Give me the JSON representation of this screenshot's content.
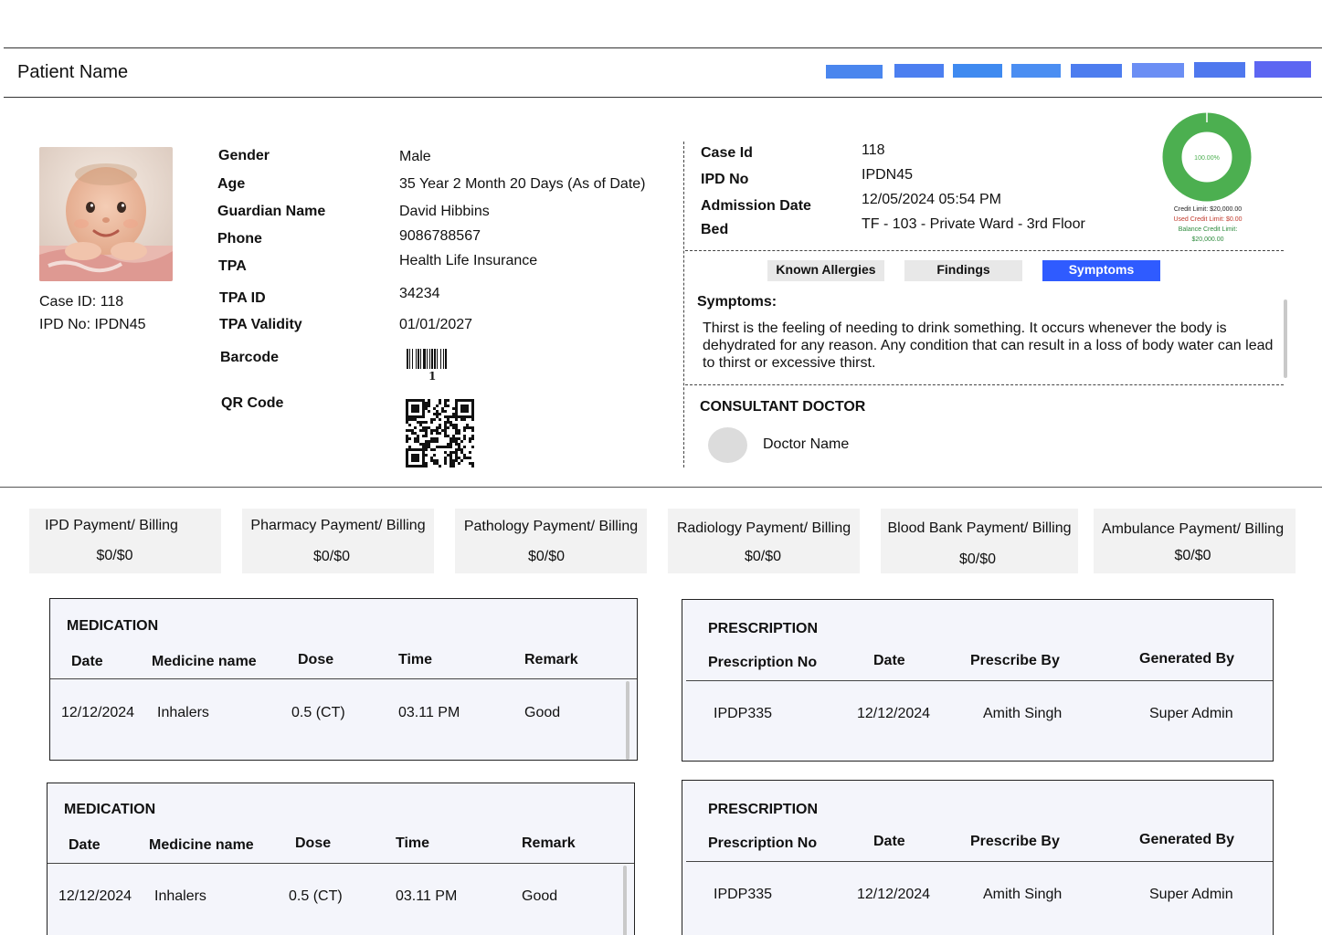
{
  "header": {
    "patient_name": "Patient Name",
    "toolbar_colors": [
      "#4a86ee",
      "#4c7ff0",
      "#3f8af0",
      "#4b8ef2",
      "#4d7def",
      "#6b8ef4",
      "#4f78ee",
      "#5d66f2"
    ]
  },
  "profile": {
    "case_id_text": "Case ID: 118",
    "ipd_no_text": "IPD No: IPDN45"
  },
  "details": {
    "gender_label": "Gender",
    "gender_value": "Male",
    "age_label": "Age",
    "age_value": "35 Year 2 Month 20 Days (As of Date)",
    "guardian_label": "Guardian Name",
    "guardian_value": "David Hibbins",
    "phone_label": "Phone",
    "phone_value": "9086788567",
    "tpa_label": "TPA",
    "tpa_value": "Health Life Insurance",
    "tpa_id_label": "TPA ID",
    "tpa_id_value": "34234",
    "tpa_validity_label": "TPA Validity",
    "tpa_validity_value": "01/01/2027",
    "barcode_label": "Barcode",
    "barcode_value": "1",
    "qr_label": "QR Code"
  },
  "case": {
    "case_id_label": "Case Id",
    "case_id_value": "118",
    "ipd_label": "IPD No",
    "ipd_value": "IPDN45",
    "admission_label": "Admission Date",
    "admission_value": "12/05/2024 05:54 PM",
    "bed_label": "Bed",
    "bed_value": "TF - 103 - Private Ward - 3rd Floor"
  },
  "credit": {
    "percent": "100.00%",
    "credit_limit": "Credit Limit: $20,000.00",
    "used_credit": "Used Credit Limit: $0.00",
    "balance_label": "Balance Credit Limit:",
    "balance_value": "$20,000.00",
    "balance_fraction": 1.0,
    "ring_color": "#4caf50",
    "used_color": "#c0392b",
    "balance_color": "#2e8b3e"
  },
  "tabs": {
    "allergies": "Known Allergies",
    "findings": "Findings",
    "symptoms": "Symptoms",
    "active": "symptoms"
  },
  "symptoms": {
    "heading": "Symptoms:",
    "text": "Thirst is the feeling of needing to drink something. It occurs whenever the body is dehydrated for any reason. Any condition that can result in a loss of body water can lead to thirst or excessive thirst."
  },
  "consultant": {
    "heading": "CONSULTANT DOCTOR",
    "doctor_name": "Doctor Name"
  },
  "billing": [
    {
      "title": "IPD Payment/ Billing",
      "value": "$0/$0"
    },
    {
      "title": "Pharmacy Payment/ Billing",
      "value": "$0/$0"
    },
    {
      "title": "Pathology Payment/ Billing",
      "value": "$0/$0"
    },
    {
      "title": "Radiology Payment/ Billing",
      "value": "$0/$0"
    },
    {
      "title": "Blood Bank Payment/ Billing",
      "value": "$0/$0"
    },
    {
      "title": "Ambulance Payment/ Billing",
      "value": "$0/$0"
    }
  ],
  "medication": [
    {
      "title": "MEDICATION",
      "headers": [
        "Date",
        "Medicine name",
        "Dose",
        "Time",
        "Remark"
      ],
      "row": [
        "12/12/2024",
        "Inhalers",
        "0.5 (CT)",
        "03.11 PM",
        "Good"
      ]
    },
    {
      "title": "MEDICATION",
      "headers": [
        "Date",
        "Medicine name",
        "Dose",
        "Time",
        "Remark"
      ],
      "row": [
        "12/12/2024",
        "Inhalers",
        "0.5 (CT)",
        "03.11 PM",
        "Good"
      ]
    }
  ],
  "prescription": [
    {
      "title": "PRESCRIPTION",
      "headers": [
        "Prescription No",
        "Date",
        "Prescribe By",
        "Generated By"
      ],
      "row": [
        "IPDP335",
        "12/12/2024",
        "Amith Singh",
        "Super Admin"
      ]
    },
    {
      "title": "PRESCRIPTION",
      "headers": [
        "Prescription No",
        "Date",
        "Prescribe By",
        "Generated By"
      ],
      "row": [
        "IPDP335",
        "12/12/2024",
        "Amith Singh",
        "Super Admin"
      ]
    }
  ]
}
